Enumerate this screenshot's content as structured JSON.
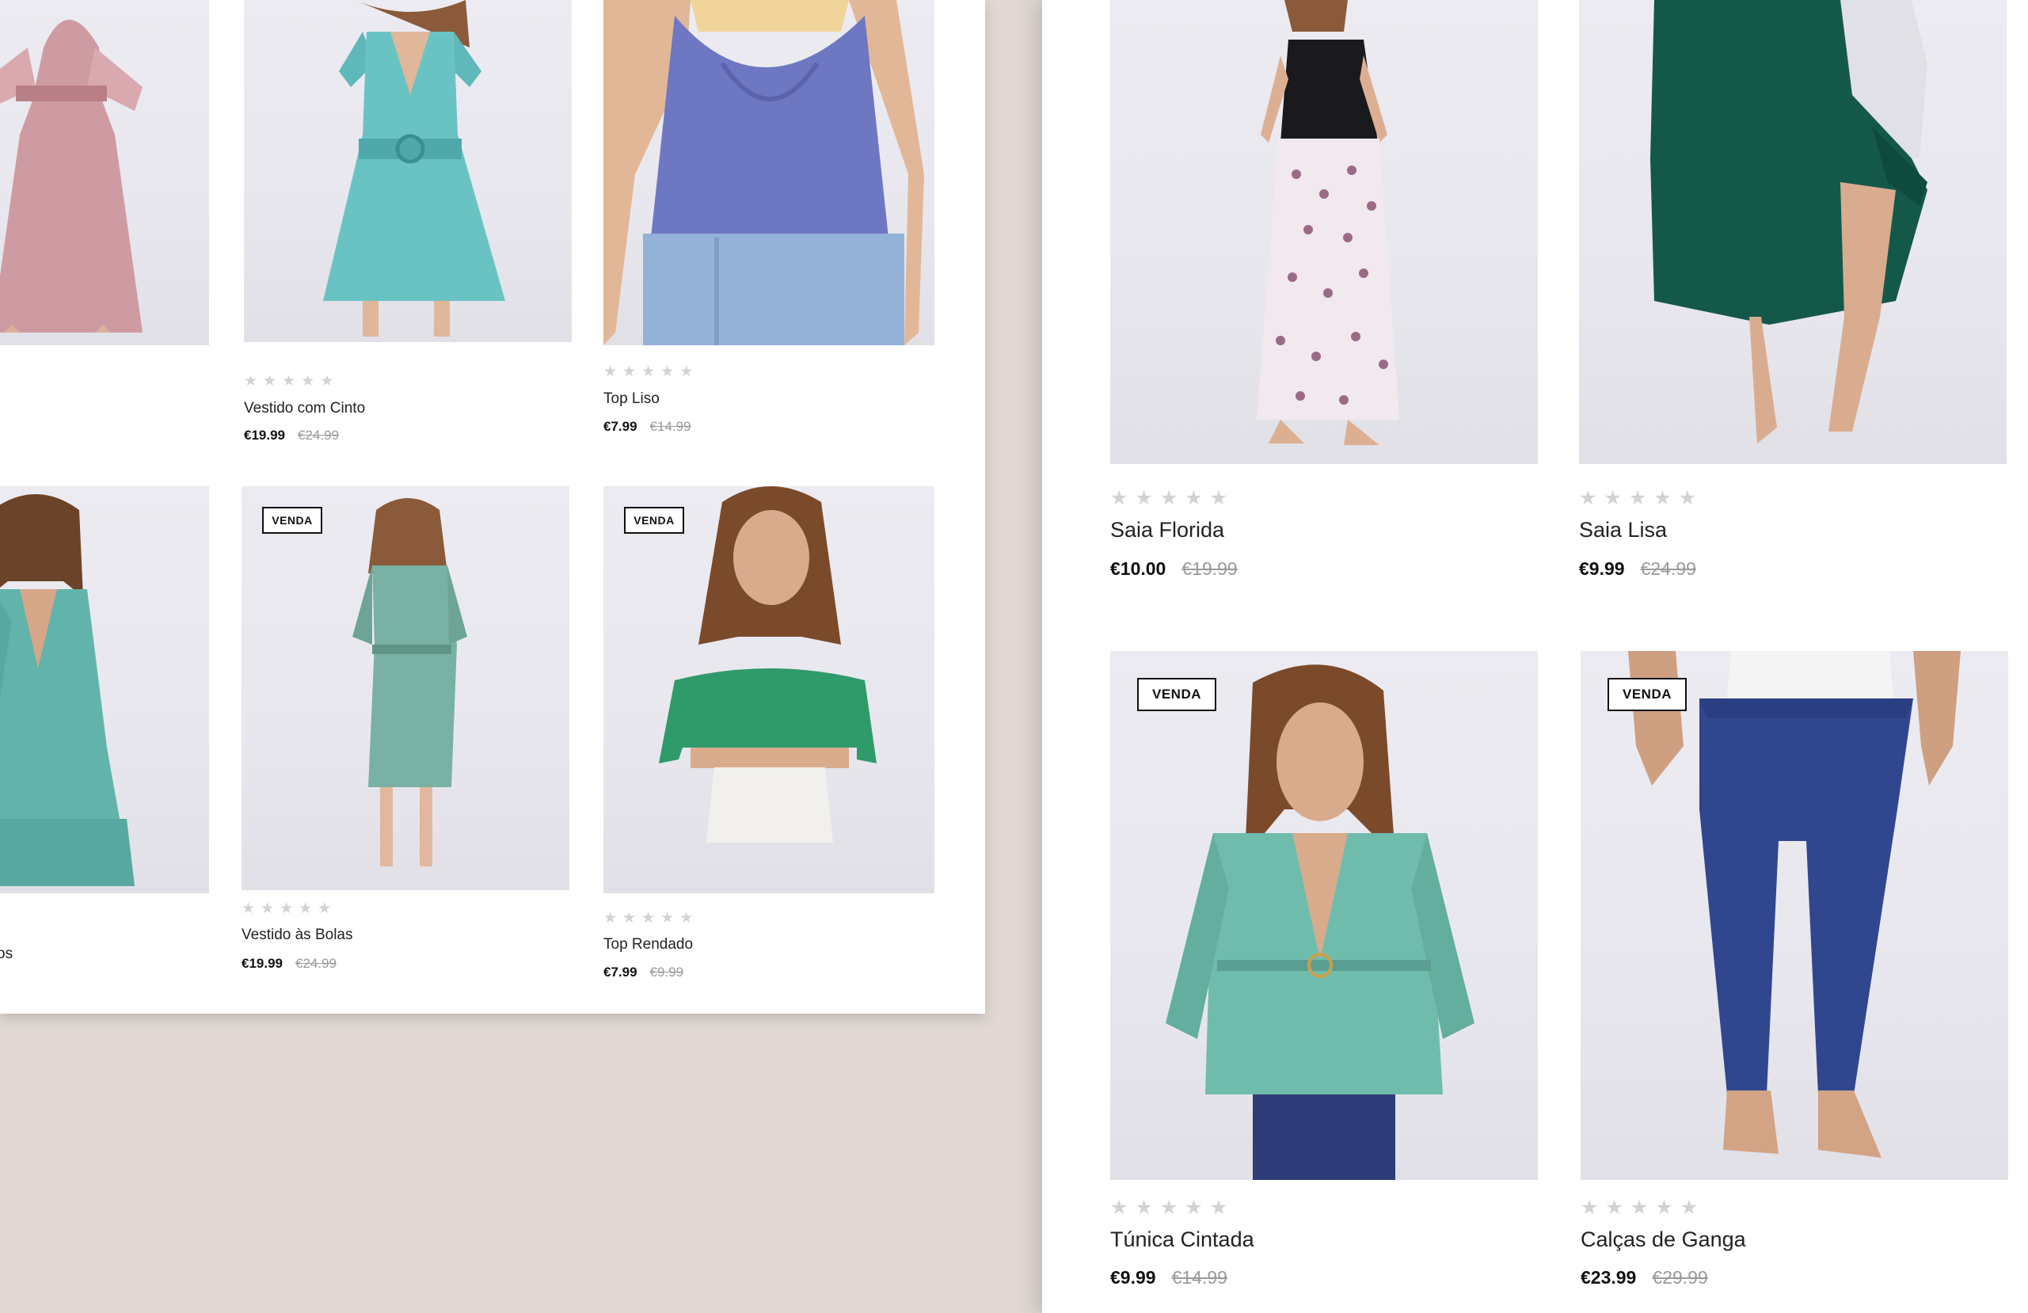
{
  "products": {
    "vestido_rosa": {},
    "vestido_com_cinto": {
      "name": "Vestido com Cinto",
      "price": "€19.99",
      "old_price": "€24.99"
    },
    "top_liso": {
      "name": "Top Liso",
      "price": "€7.99",
      "old_price": "€14.99"
    },
    "vestido_folhos": {
      "name_fragment": "os"
    },
    "vestido_as_bolas": {
      "badge": "VENDA",
      "name": "Vestido às Bolas",
      "price": "€19.99",
      "old_price": "€24.99"
    },
    "top_rendado": {
      "badge": "VENDA",
      "name": "Top Rendado",
      "price": "€7.99",
      "old_price": "€9.99"
    },
    "saia_florida": {
      "name": "Saia Florida",
      "price": "€10.00",
      "old_price": "€19.99"
    },
    "saia_lisa": {
      "name": "Saia Lisa",
      "price": "€9.99",
      "old_price": "€24.99"
    },
    "tunica_cintada": {
      "badge": "VENDA",
      "name": "Túnica Cintada",
      "price": "€9.99",
      "old_price": "€14.99"
    },
    "calcas_de_ganga": {
      "badge": "VENDA",
      "name": "Calças de Ganga",
      "price": "€23.99",
      "old_price": "€29.99"
    }
  },
  "rating": {
    "stars_max": 5,
    "stars_filled": 0,
    "glyph": "★"
  },
  "colors": {
    "background": "#e2d8d3",
    "panel": "#ffffff",
    "star_empty": "#d2d2d2",
    "old_price": "#9a9a9a",
    "text": "#111111"
  }
}
